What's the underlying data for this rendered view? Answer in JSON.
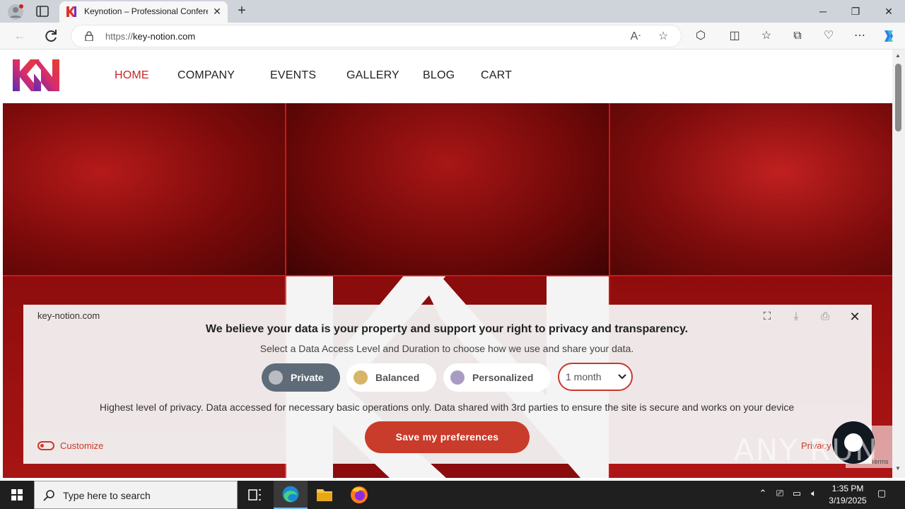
{
  "browser": {
    "tab_title": "Keynotion – Professional Confere",
    "url_scheme": "https://",
    "url_host": "key-notion.com",
    "new_tab_symbol": "+",
    "close_tab_symbol": "✕"
  },
  "site": {
    "nav": [
      {
        "label": "HOME",
        "active": true
      },
      {
        "label": "COMPANY",
        "active": false
      },
      {
        "label": "EVENTS",
        "active": false
      },
      {
        "label": "GALLERY",
        "active": false
      },
      {
        "label": "BLOG",
        "active": false
      },
      {
        "label": "CART",
        "active": false
      }
    ]
  },
  "consent": {
    "domain": "key-notion.com",
    "headline": "We believe your data is your property and support your right to privacy and transparency.",
    "subtitle": "Select a Data Access Level and Duration to choose how we use and share your data.",
    "levels": [
      {
        "label": "Private",
        "color": "#b9bcc2",
        "selected": true
      },
      {
        "label": "Balanced",
        "color": "#d8b468",
        "selected": false
      },
      {
        "label": "Personalized",
        "color": "#a99cc4",
        "selected": false
      }
    ],
    "duration": "1 month",
    "description": "Highest level of privacy. Data accessed for necessary basic operations only. Data shared with 3rd parties to ensure the site is secure and works on your device",
    "save_label": "Save my preferences",
    "customize_label": "Customize",
    "privacy_label": "Privacy"
  },
  "overlays": {
    "recaptcha_terms": "Terms",
    "watermark": "ANY RUN"
  },
  "taskbar": {
    "search_placeholder": "Type here to search",
    "time": "1:35 PM",
    "date": "3/19/2025"
  },
  "colors": {
    "accent": "#c93b2a",
    "nav_active": "#c62828",
    "hero_red": "#8c0c0c"
  }
}
